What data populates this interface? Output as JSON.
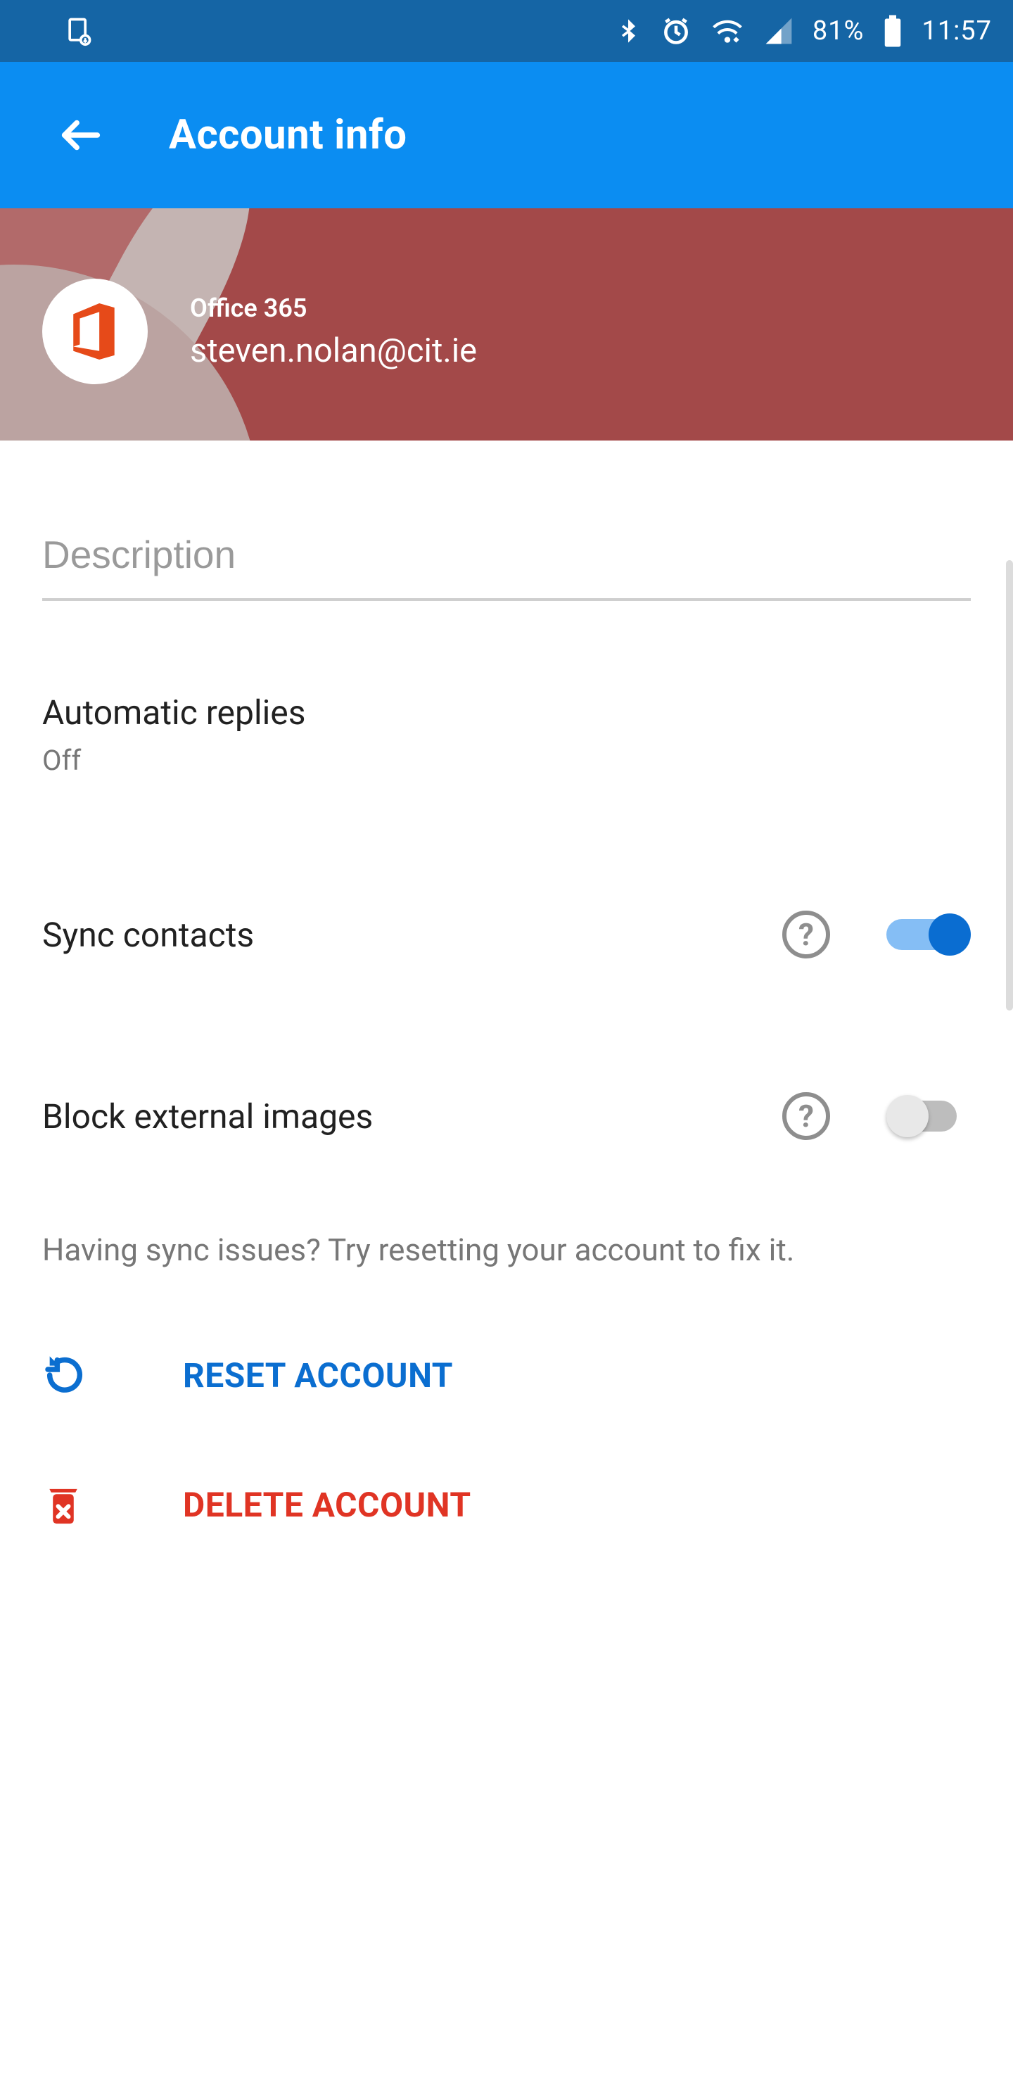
{
  "statusbar": {
    "battery_pct": "81%",
    "time": "11:57"
  },
  "appbar": {
    "title": "Account info"
  },
  "account": {
    "provider": "Office 365",
    "email": "steven.nolan@cit.ie"
  },
  "settings": {
    "description_placeholder": "Description",
    "auto_replies": {
      "label": "Automatic replies",
      "value": "Off"
    },
    "sync_contacts": {
      "label": "Sync contacts",
      "enabled": true
    },
    "block_images": {
      "label": "Block external images",
      "enabled": false
    },
    "hint": "Having sync issues? Try resetting your account to fix it.",
    "reset_label": "RESET ACCOUNT",
    "delete_label": "DELETE ACCOUNT"
  }
}
